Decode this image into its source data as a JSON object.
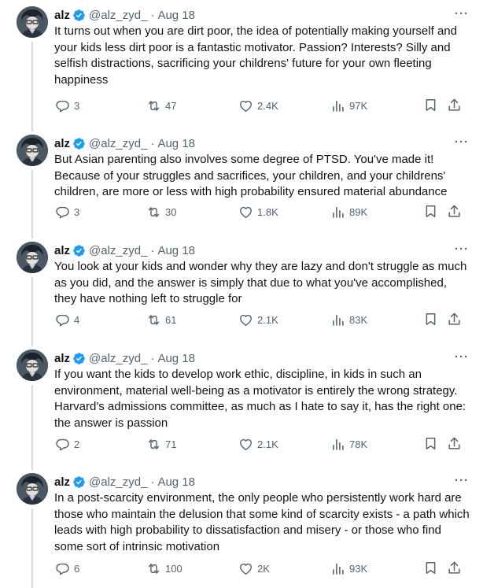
{
  "tweets": [
    {
      "name": "alz",
      "handle": "@alz_zyd_",
      "separator": "·",
      "date": "Aug 18",
      "text": "It turns out when you are dirt poor, the idea of potentially making yourself and your kids less dirt poor is a fantastic motivator. Passion? Interests? Silly and selfish distractions, sacrificing your childrens' future for your own fleeting happiness",
      "replies": "3",
      "reposts": "47",
      "likes": "2.4K",
      "views": "97K"
    },
    {
      "name": "alz",
      "handle": "@alz_zyd_",
      "separator": "·",
      "date": "Aug 18",
      "text": "But Asian parenting also involves some degree of PTSD. You've made it! Because of your struggles and sacrifices, your children, and your childrens' children, are more or less with high probability ensured material abundance",
      "replies": "3",
      "reposts": "30",
      "likes": "1.8K",
      "views": "89K"
    },
    {
      "name": "alz",
      "handle": "@alz_zyd_",
      "separator": "·",
      "date": "Aug 18",
      "text": "You look at your kids and wonder why they are lazy and don't struggle as much as you did, and the answer is simply that due to what you've accomplished, they have nothing left to struggle for",
      "replies": "4",
      "reposts": "61",
      "likes": "2.1K",
      "views": "83K"
    },
    {
      "name": "alz",
      "handle": "@alz_zyd_",
      "separator": "·",
      "date": "Aug 18",
      "text": "If you want the kids to develop work ethic, discipline, in kids in such an environment, material well-being as a motivator is entirely the wrong strategy. Harvard's admissions committee, as much as I hate to say it, has the right one: the answer is passion",
      "replies": "2",
      "reposts": "71",
      "likes": "2.1K",
      "views": "78K"
    },
    {
      "name": "alz",
      "handle": "@alz_zyd_",
      "separator": "·",
      "date": "Aug 18",
      "text": "In a post-scarcity environment, the only people who persistently work hard are those who maintain the delusion that some kind of scarcity exists - a path which leads with high probability to dissatisfaction and misery - or those who find some sort of intrinsic motivation",
      "replies": "6",
      "reposts": "100",
      "likes": "2K",
      "views": "93K"
    }
  ],
  "colors": {
    "text": "#0f1419",
    "secondary": "#536471",
    "verified": "#1d9bf0",
    "thread_line": "#cfd9de"
  },
  "icons": [
    "verified-icon",
    "more-icon",
    "reply-icon",
    "repost-icon",
    "like-icon",
    "views-icon",
    "bookmark-icon",
    "share-icon"
  ]
}
